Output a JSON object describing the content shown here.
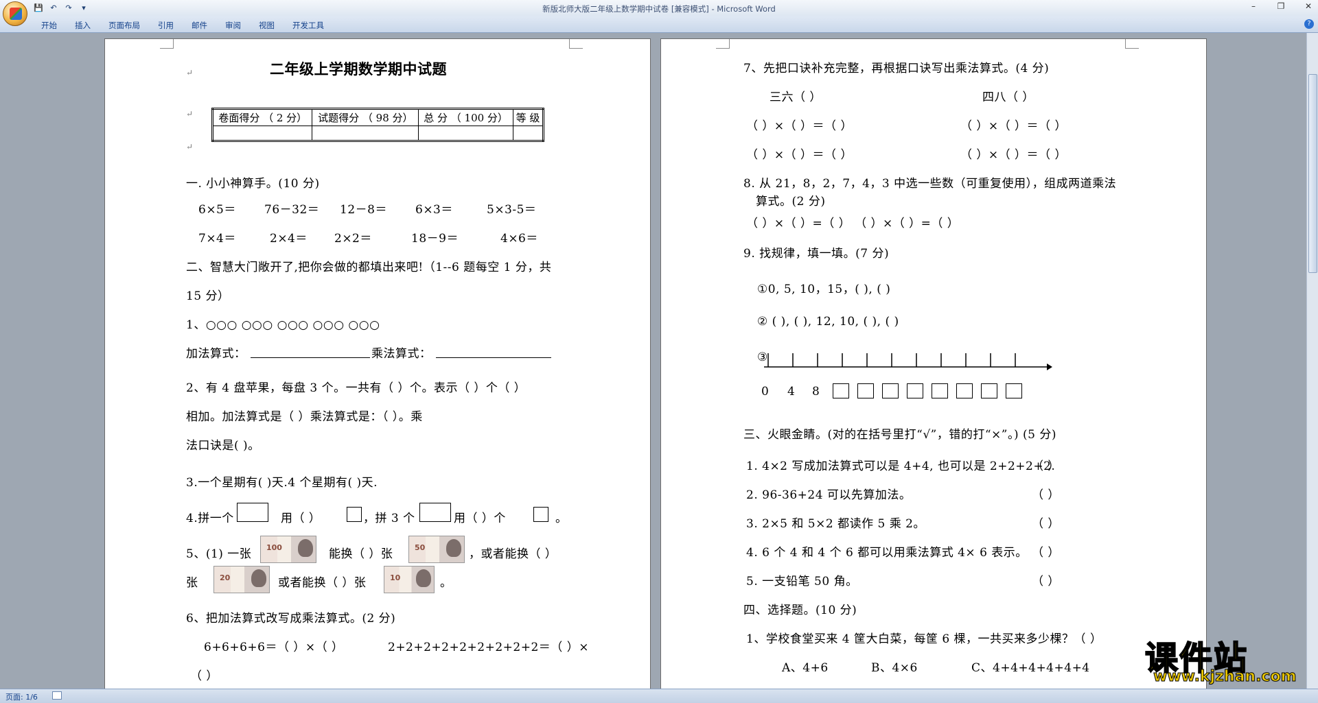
{
  "window": {
    "title": "新版北师大版二年级上数学期中试卷 [兼容模式] - Microsoft Word",
    "tabs": [
      "开始",
      "插入",
      "页面布局",
      "引用",
      "邮件",
      "审阅",
      "视图",
      "开发工具"
    ],
    "status": "页面: 1/6"
  },
  "left_page": {
    "title": "二年级上学期数学期中试题",
    "score_headers": [
      "卷面得分 （ 2  分）",
      "试题得分 （ 98  分）",
      "总   分 （ 100 分）",
      "等 级"
    ],
    "s1_title": "一. 小小神算手。(10 分)",
    "s1_row1": [
      "6×5＝",
      "76－32＝",
      "12－8＝",
      "6×3＝",
      "5×3-5＝"
    ],
    "s1_row2": [
      "7×4＝",
      "2×4＝",
      "2×2＝",
      "18－9＝",
      "4×6＝"
    ],
    "s2_title_a": "二、智慧大门敞开了,把你会做的都填出来吧!（1--6 题每空 1 分，共",
    "s2_title_b": "15 分）",
    "q1": "1、○○○   ○○○ ○○○   ○○○ ○○○",
    "q1_add": "加法算式：",
    "q1_mul": "乘法算式：",
    "q2_a": "2、有 4 盘苹果，每盘 3 个。一共有（    ）个。表示（     ）个（     ）",
    "q2_b": "相加。加法算式是（          ）乘法算式是：（                ）。乘",
    "q2_c": "法口诀是(           )。",
    "q3": "3.一个星期有(      )天.4 个星期有(       )天.",
    "q4_a": "4.拼一个",
    "q4_b": "用（      ）",
    "q4_c": "，拼 3 个",
    "q4_d": "用（    ）个",
    "q4_e": "。",
    "q5_a": "5、(1) 一张",
    "q5_b": "能换（    ）张",
    "q5_c": "，或者能换（    ）",
    "q5_d": "张",
    "q5_e": "或者能换（    ）张",
    "q5_f": "。",
    "money_100": "100",
    "money_50": "50",
    "money_20": "20",
    "money_10": "10",
    "q6": "6、把加法算式改写成乘法算式。(2 分)",
    "q6_a": "6+6+6+6＝（    ）×（    ）",
    "q6_b": "2+2+2+2+2+2+2+2+2＝（    ）×",
    "q6_c": "（    ）"
  },
  "right_page": {
    "q7": "7、先把口诀补充完整，再根据口诀写出乘法算式。(4 分)",
    "q7_k1": "三六（            ）",
    "q7_k2": "四八（            ）",
    "q7_eq": "（   ）×（   ）＝（     ）",
    "q8_a": "8. 从 21，8，2，7，4，3 中选一些数（可重复使用），组成两道乘法",
    "q8_b": "算式。(2 分)",
    "q8_c": "（          ）×（   ）=（   ）          （       ）×（      ）=（        ）",
    "q9": "9. 找规律，填一填。(7 分)",
    "q9_1": "①0, 5, 10，15，(          ), (          )",
    "q9_2": "② (    ), (    ), 12, 10, (          ), (          )",
    "q9_3": "③",
    "nl_labels": [
      "0",
      "4",
      "8"
    ],
    "s3_title": "三、火眼金睛。(对的在括号里打“√”，错的打“×”。) (5 分)",
    "s3_items": [
      "1. 4×2 写成加法算式可以是 4+4, 也可以是 2+2+2+2.",
      "2. 96-36+24 可以先算加法。",
      "3. 2×5 和 5×2 都读作 5 乘 2。",
      "4. 6 个 4 和 4 个 6 都可以用乘法算式 4×  6 表示。",
      "5. 一支铅笔 50 角。"
    ],
    "s3_paren": "（      ）",
    "s4_title": "四、选择题。(10 分)",
    "s4_q1": "1、学校食堂买来 4 筐大白菜，每筐 6 棵，一共买来多少棵？（      ）",
    "s4_opts": [
      "A、4+6",
      "B、4×6",
      "C、4+4+4+4+4+4"
    ]
  },
  "watermark": {
    "line1": "课件站",
    "line2": "www.kjzhan.com"
  }
}
